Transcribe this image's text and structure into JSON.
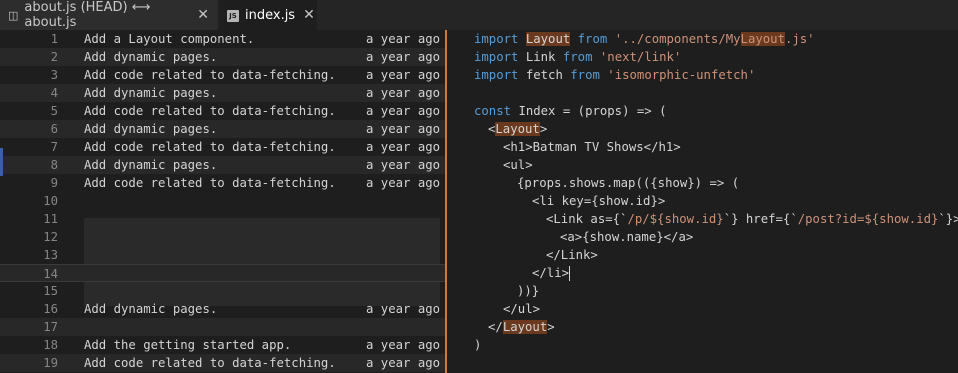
{
  "tabs": [
    {
      "icon": "diff-icon",
      "label": "about.js (HEAD) ⟷ about.js",
      "close": "✕"
    },
    {
      "icon": "js-file-icon",
      "badge": "JS",
      "label": "index.js",
      "close": "✕"
    }
  ],
  "blame": [
    {
      "line": "1",
      "message": "Add a Layout component.",
      "ago": "a year ago"
    },
    {
      "line": "2",
      "message": "Add dynamic pages.",
      "ago": "a year ago"
    },
    {
      "line": "3",
      "message": "Add code related to data-fetching.",
      "ago": "a year ago"
    },
    {
      "line": "4",
      "message": "Add dynamic pages.",
      "ago": "a year ago"
    },
    {
      "line": "5",
      "message": "Add code related to data-fetching.",
      "ago": "a year ago"
    },
    {
      "line": "6",
      "message": "Add dynamic pages.",
      "ago": "a year ago"
    },
    {
      "line": "7",
      "message": "Add code related to data-fetching.",
      "ago": "a year ago"
    },
    {
      "line": "8",
      "message": "Add dynamic pages.",
      "ago": "a year ago"
    },
    {
      "line": "9",
      "message": "Add code related to data-fetching.",
      "ago": "a year ago"
    },
    {
      "line": "10",
      "message": "",
      "ago": ""
    },
    {
      "line": "11",
      "message": "",
      "ago": ""
    },
    {
      "line": "12",
      "message": "",
      "ago": ""
    },
    {
      "line": "13",
      "message": "",
      "ago": ""
    },
    {
      "line": "14",
      "message": "",
      "ago": ""
    },
    {
      "line": "15",
      "message": "",
      "ago": ""
    },
    {
      "line": "16",
      "message": "Add dynamic pages.",
      "ago": "a year ago"
    },
    {
      "line": "17",
      "message": "",
      "ago": ""
    },
    {
      "line": "18",
      "message": "Add the getting started app.",
      "ago": "a year ago"
    },
    {
      "line": "19",
      "message": "Add code related to data-fetching.",
      "ago": "a year ago"
    }
  ],
  "code": {
    "l1": {
      "kw1": "import",
      "hl": "Layout",
      "kw2": "from",
      "str1": "'../components/My",
      "strhl": "Layout",
      "str2": ".js'"
    },
    "l2": {
      "kw1": "import",
      "txt": "Link",
      "kw2": "from",
      "str": "'next/link'"
    },
    "l3": {
      "kw1": "import",
      "txt": "fetch",
      "kw2": "from",
      "str": "'isomorphic-unfetch'"
    },
    "l5": {
      "kw": "const",
      "txt": "Index = (props) => ("
    },
    "l6": {
      "pre": "<",
      "hl": "Layout",
      "post": ">"
    },
    "l7": "<h1>Batman TV Shows</h1>",
    "l8": "<ul>",
    "l9": "{props.shows.map(({show}) => (",
    "l10": "<li key={show.id}>",
    "l11": {
      "pre": "<Link as={`",
      "str1": "/p/${show.id}",
      "mid": "`} href={`",
      "str2": "/post?id=${show.id}",
      "post": "`}>"
    },
    "l12": "<a>{show.name}</a>",
    "l13": "</Link>",
    "l14": "</li>",
    "l15": "))}",
    "l16": "</ul>",
    "l17": {
      "pre": "</",
      "hl": "Layout",
      "post": ">"
    },
    "l18": ")"
  }
}
